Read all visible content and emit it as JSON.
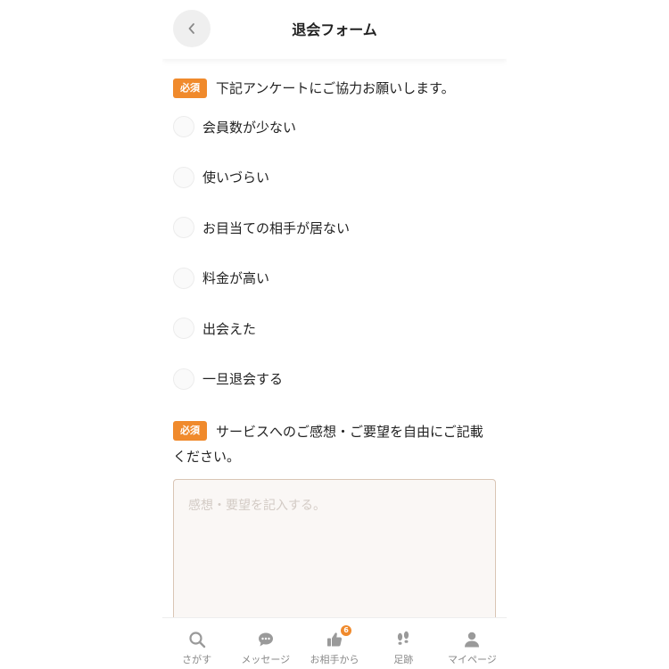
{
  "header": {
    "title": "退会フォーム",
    "back_icon": "chevron-left-icon"
  },
  "question1": {
    "badge": "必須",
    "text": "下記アンケートにご協力お願いします。",
    "options": [
      "会員数が少ない",
      "使いづらい",
      "お目当ての相手が居ない",
      "料金が高い",
      "出会えた",
      "一旦退会する"
    ]
  },
  "question2": {
    "badge": "必須",
    "text": "サービスへのご感想・ご要望を自由にご記載ください。",
    "placeholder": "感想・要望を記入する。",
    "value": ""
  },
  "tabbar": {
    "items": [
      {
        "label": "さがす",
        "icon": "search-icon"
      },
      {
        "label": "メッセージ",
        "icon": "chat-icon"
      },
      {
        "label": "お相手から",
        "icon": "thumbs-up-icon",
        "badge": "6"
      },
      {
        "label": "足跡",
        "icon": "footprints-icon"
      },
      {
        "label": "マイページ",
        "icon": "person-icon"
      }
    ]
  },
  "colors": {
    "accent": "#f08a2c",
    "textarea_bg": "#faf7f5",
    "textarea_border": "#d9c5b5",
    "icon": "#9a9a9a"
  }
}
